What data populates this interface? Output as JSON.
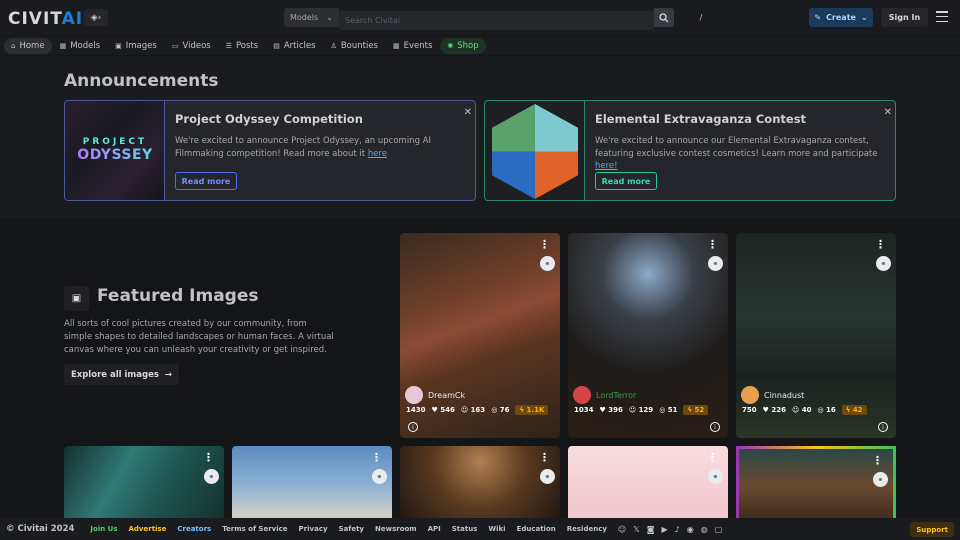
{
  "header": {
    "logo_main": "CIVIT",
    "logo_accent": "AI",
    "search_type": "Models",
    "search_placeholder": "Search Civitai",
    "search_shortcut": "/",
    "create_label": "Create",
    "signin_label": "Sign In"
  },
  "nav": [
    {
      "label": "Home",
      "icon": "⌂"
    },
    {
      "label": "Models",
      "icon": "▦"
    },
    {
      "label": "Images",
      "icon": "▣"
    },
    {
      "label": "Videos",
      "icon": "▭"
    },
    {
      "label": "Posts",
      "icon": "☰"
    },
    {
      "label": "Articles",
      "icon": "▤"
    },
    {
      "label": "Bounties",
      "icon": "♙"
    },
    {
      "label": "Events",
      "icon": "▦"
    },
    {
      "label": "Shop",
      "icon": "✺"
    }
  ],
  "announcements": {
    "title": "Announcements",
    "items": [
      {
        "title": "Project Odyssey Competition",
        "text": "We're excited to announce Project Odyssey, an upcoming AI Filmmaking competition! Read more about it ",
        "link": "here",
        "button": "Read more",
        "thumb_top": "PROJECT",
        "thumb_bottom": "ODYSSEY"
      },
      {
        "title": "Elemental Extravaganza Contest",
        "text": "We're excited to announce our Elemental Extravaganza contest, featuring exclusive contest cosmetics! Learn more and participate ",
        "link": "here!",
        "button": "Read more"
      }
    ]
  },
  "featured": {
    "title": "Featured Images",
    "description": "All sorts of cool pictures created by our community, from simple shapes to detailed landscapes or human faces. A virtual canvas where you can unleash your creativity or get inspired.",
    "explore_label": "Explore all images",
    "cards": [
      {
        "user": "DreamCk",
        "stats": [
          "1430",
          "546",
          "163",
          "76"
        ],
        "buzz": "1.1K"
      },
      {
        "user": "LordTerror",
        "stats": [
          "1034",
          "396",
          "129",
          "51"
        ],
        "buzz": "52"
      },
      {
        "user": "Cinnadust",
        "stats": [
          "750",
          "226",
          "40",
          "16"
        ],
        "buzz": "42"
      }
    ]
  },
  "footer": {
    "copyright": "© Civitai 2024",
    "links": [
      "Join Us",
      "Advertise",
      "Creators",
      "Terms of Service",
      "Privacy",
      "Safety",
      "Newsroom",
      "API",
      "Status",
      "Wiki",
      "Education",
      "Residency"
    ],
    "socials": [
      "discord-icon",
      "x-icon",
      "instagram-icon",
      "youtube-icon",
      "tiktok-icon",
      "reddit-icon",
      "github-icon",
      "chat-icon"
    ],
    "support_label": "Support"
  }
}
